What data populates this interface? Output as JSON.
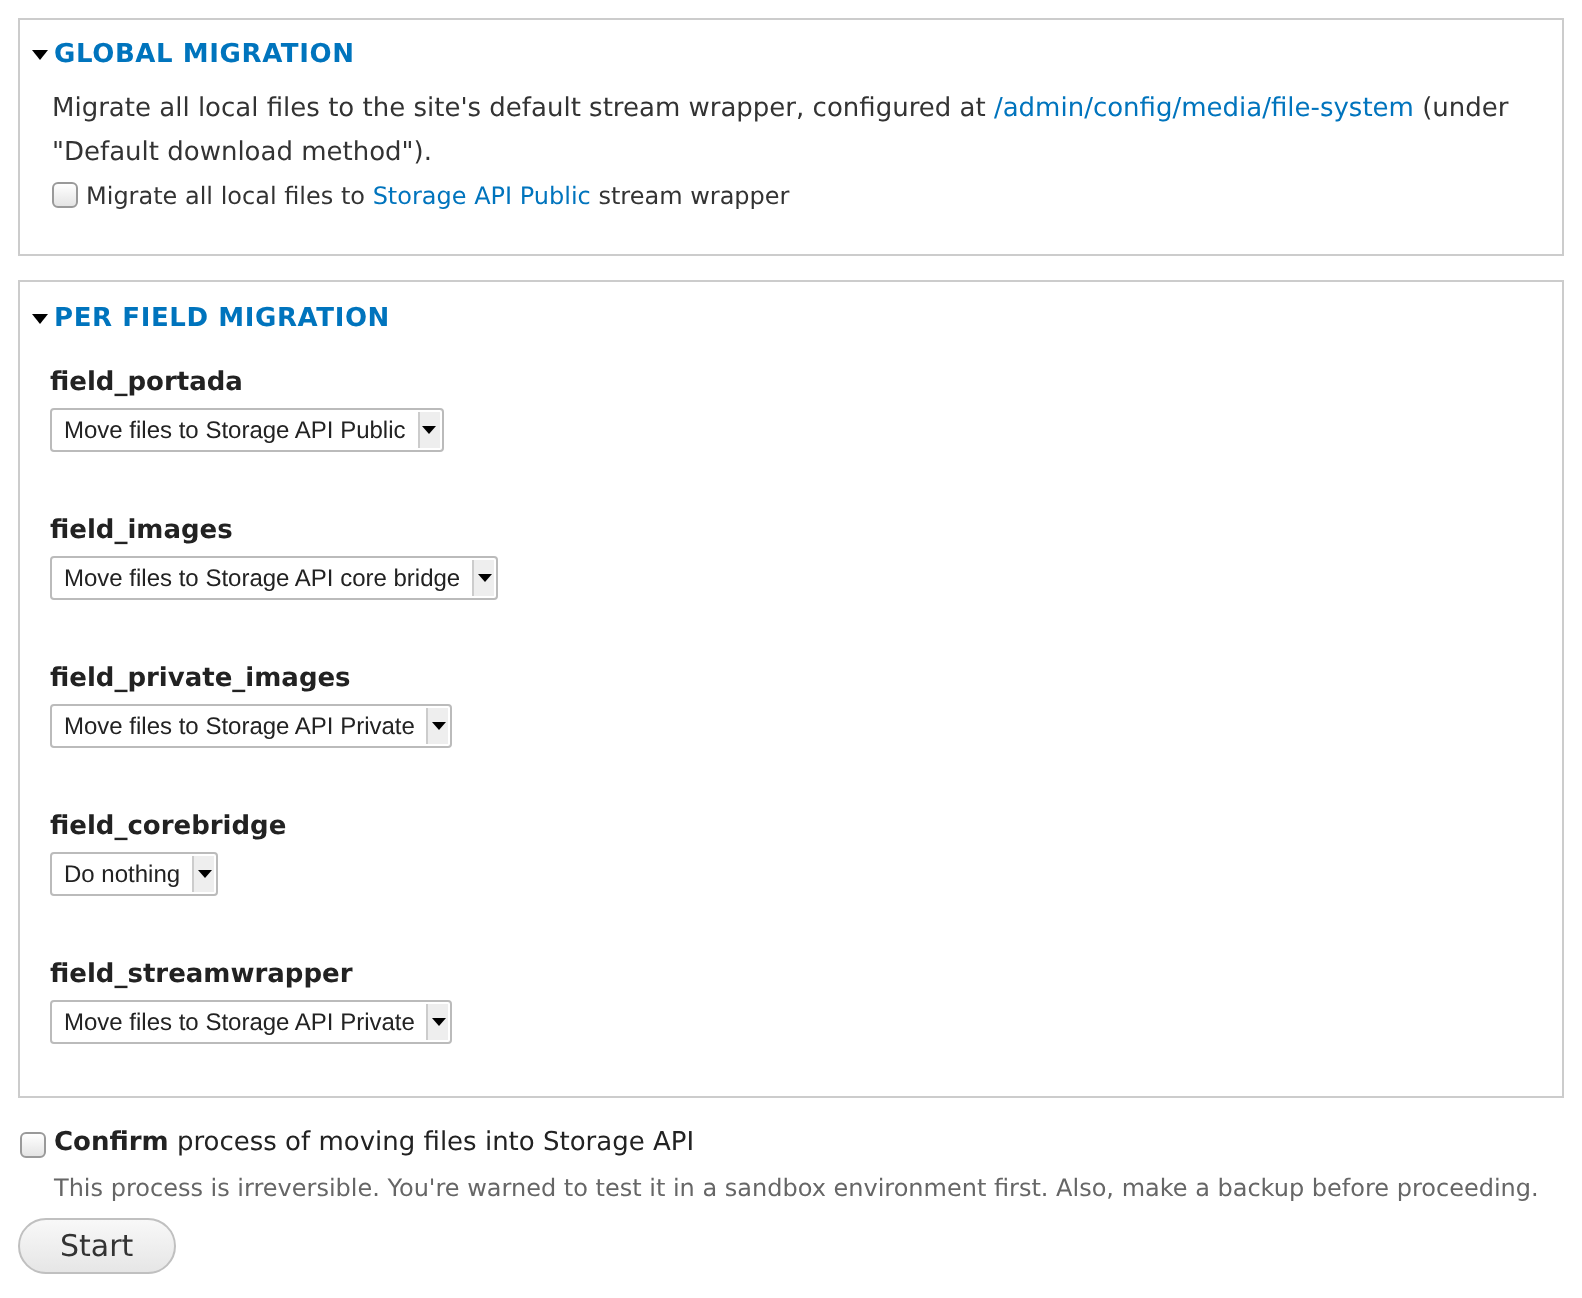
{
  "global_migration": {
    "title": "GLOBAL MIGRATION",
    "expanded": true,
    "description": {
      "before": "Migrate all local files to the site's default stream wrapper, configured at ",
      "link": "/admin/config/media/file-system",
      "after": " (under \"Default download method\")."
    },
    "checkbox": {
      "checked": false,
      "before": "Migrate all local files to ",
      "link": "Storage API Public",
      "after": " stream wrapper"
    }
  },
  "per_field_migration": {
    "title": "PER FIELD MIGRATION",
    "expanded": true,
    "fields": [
      {
        "label": "field_portada",
        "value": "Move files to Storage API Public"
      },
      {
        "label": "field_images",
        "value": "Move files to Storage API core bridge"
      },
      {
        "label": "field_private_images",
        "value": "Move files to Storage API Private"
      },
      {
        "label": "field_corebridge",
        "value": "Do nothing"
      },
      {
        "label": "field_streamwrapper",
        "value": "Move files to Storage API Private"
      }
    ]
  },
  "confirm": {
    "checked": false,
    "label": "**Confirm** process of moving files into Storage API",
    "description": "This process is irreversible. You're warned to test it in a sandbox environment first. Also, make a backup before proceeding."
  },
  "button": "Start"
}
